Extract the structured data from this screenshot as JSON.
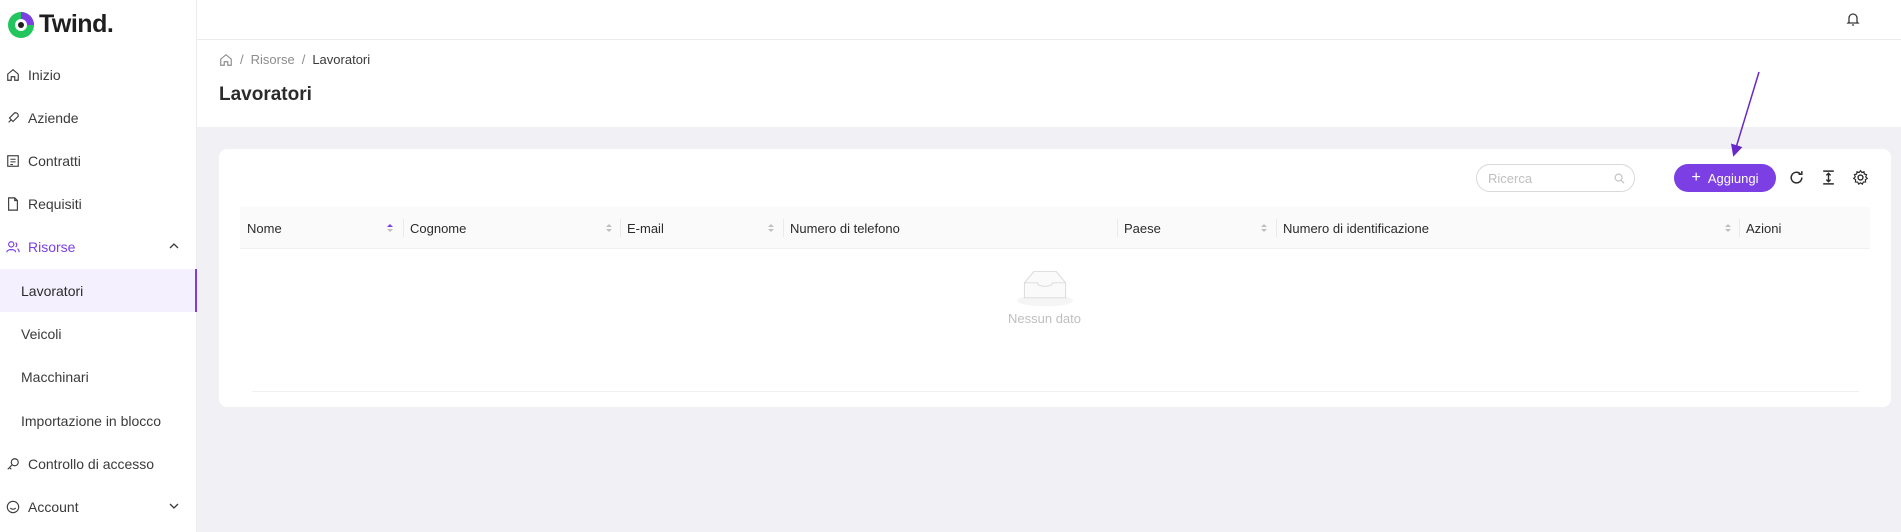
{
  "brand": {
    "name": "Twind."
  },
  "sidebar": {
    "items": [
      {
        "label": "Inizio",
        "icon": "home-icon"
      },
      {
        "label": "Aziende",
        "icon": "rocket-icon"
      },
      {
        "label": "Contratti",
        "icon": "contract-icon"
      },
      {
        "label": "Requisiti",
        "icon": "document-icon"
      },
      {
        "label": "Risorse",
        "icon": "users-icon",
        "expanded": true
      },
      {
        "label": "Controllo di accesso",
        "icon": "key-icon"
      },
      {
        "label": "Account",
        "icon": "account-icon"
      }
    ],
    "subitems": [
      {
        "label": "Lavoratori",
        "selected": true
      },
      {
        "label": "Veicoli"
      },
      {
        "label": "Macchinari"
      },
      {
        "label": "Importazione in blocco"
      }
    ]
  },
  "header": {
    "breadcrumb": [
      "Risorse",
      "Lavoratori"
    ],
    "title": "Lavoratori"
  },
  "toolbar": {
    "search_placeholder": "Ricerca",
    "add_label": "Aggiungi"
  },
  "table": {
    "columns": [
      "Nome",
      "Cognome",
      "E-mail",
      "Numero di telefono",
      "Paese",
      "Numero di identificazione",
      "Azioni"
    ],
    "rows": [],
    "empty_text": "Nessun dato"
  },
  "colors": {
    "accent": "#7b3fe4",
    "background": "#f0f0f5"
  }
}
